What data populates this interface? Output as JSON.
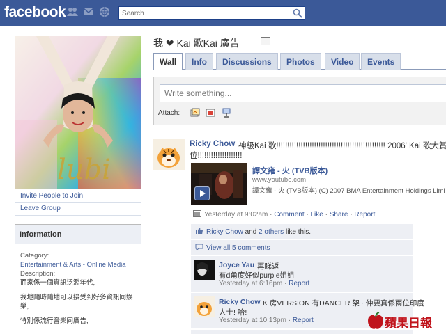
{
  "topbar": {
    "logo": "facebook",
    "search_placeholder": "Search",
    "icons": [
      "friend-requests-icon",
      "messages-icon",
      "notifications-icon"
    ]
  },
  "left": {
    "invite": "Invite People to Join",
    "leave": "Leave Group",
    "info": {
      "heading": "Information",
      "category_label": "Category:",
      "category_value": "Entertainment & Arts - Online Media",
      "description_label": "Description:",
      "desc_line1": "而家係一個資訊泛濫年代,",
      "desc_line2": "我地隨時隨地可以接受到好多資訊同娛樂,",
      "desc_line3": "特別係流行音樂同廣告,"
    }
  },
  "page": {
    "title": "我 ❤ Kai 歌Kai 廣告"
  },
  "tabs": [
    "Wall",
    "Info",
    "Discussions",
    "Photos",
    "Video",
    "Events"
  ],
  "composer": {
    "placeholder": "Write something...",
    "attach_label": "Attach:"
  },
  "story": {
    "author": "Ricky Chow",
    "text_line1": "神級Kai 歌!!!!!!!!!!!!!!!!!!!!!!!!!!!!!!!!!!!!!!!!!!!!!!!!! 2006' Kai 歌大賞第",
    "text_line2": "位!!!!!!!!!!!!!!!!!!!!",
    "video": {
      "title": "譚文雍 - 火 (TVB版本)",
      "domain": "www.youtube.com",
      "desc": "譚文雍 - 火 (TVB版本) (C) 2007 BMA Entertainment Holdings Limi"
    },
    "meta": {
      "time": "Yesterday at 9:02am",
      "sep": " · ",
      "comment": "Comment",
      "like": "Like",
      "share": "Share",
      "report": "Report"
    },
    "likes": {
      "author": "Ricky Chow",
      "and": " and ",
      "others": "2 others",
      "suffix": " like this."
    },
    "view_all": "View all 5 comments",
    "comments": [
      {
        "author": "Joyce Yau",
        "text": "再睇返",
        "text2": "有d角度好似purple姐姐",
        "time": "Yesterday at 6:16pm",
        "sep": " · ",
        "report": "Report"
      },
      {
        "author": "Ricky Chow",
        "text": "K 房VERSION 有DANCER 架~ 仲要真係兩位印度",
        "text2": "人士! 哈!",
        "time": "Yesterday at 10:13pm",
        "sep": " · ",
        "report": "Report"
      }
    ]
  },
  "watermark": "蘋果日報",
  "colors": {
    "brand": "#3b5998",
    "tab_bg": "#d8dfea",
    "comment_bg": "#edeff4",
    "watermark": "#c0141c"
  }
}
